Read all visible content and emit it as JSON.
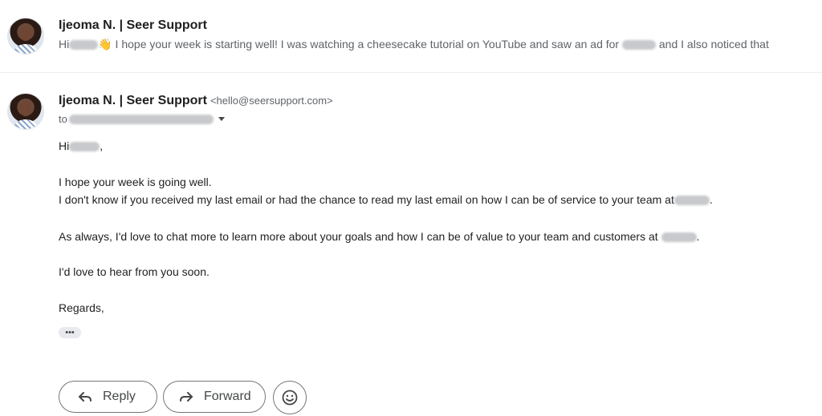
{
  "thread_preview": {
    "sender": "Ijeoma N. | Seer Support",
    "snippet_greeting": "Hi",
    "snippet_emoji": "👋",
    "snippet_text_1": " I hope your week is starting well! I was watching a cheesecake tutorial on YouTube and saw an ad for ",
    "snippet_text_2": " and I also noticed that"
  },
  "message": {
    "sender": "Ijeoma N. | Seer Support",
    "sender_email": "<hello@seersupport.com>",
    "to_label": "to",
    "greeting": "Hi",
    "greeting_punct": ",",
    "line1": "I hope your week is going well.",
    "line2": "I don't know if you received my last email or had the chance to read my last email on how I can be of service to your team at",
    "line2_end": ".",
    "line3": "As always, I'd love to chat more to learn more about your goals and how I can be of value to your team and customers at",
    "line3_end": ".",
    "line4": "I'd love to hear from you soon.",
    "line5": "Regards,",
    "trimmed_indicator": "•••"
  },
  "actions": {
    "reply_label": "Reply",
    "forward_label": "Forward"
  }
}
